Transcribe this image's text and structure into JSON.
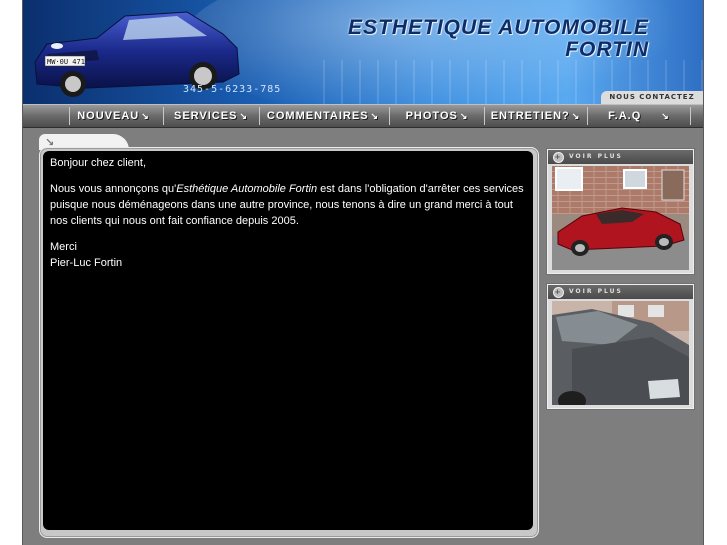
{
  "header": {
    "title_line1": "ESTHETIQUE AUTOMOBILE",
    "title_line2": "FORTIN",
    "phone": "345-5-6233-785",
    "contact_tab": "NOUS CONTACTEZ",
    "plate": "MW·0U 471"
  },
  "nav": {
    "items": [
      {
        "label": "NOUVEAU"
      },
      {
        "label": "SERVICES"
      },
      {
        "label": "COMMENTAIRES"
      },
      {
        "label": "PHOTOS"
      },
      {
        "label": "ENTRETIEN?"
      },
      {
        "label": "F.A.Q"
      }
    ],
    "arrow": "↘"
  },
  "content": {
    "greeting": "Bonjour chez client,",
    "para_before": "Nous vous annonçons qu'",
    "company_name": "Esthétique Automobile Fortin",
    "para_after": " est dans l'obligation d'arrêter ces services puisque nous déménageons dans une autre province, nous tenons à dire un grand merci à tout nos clients qui nous ont fait confiance depuis 2005.",
    "thanks": "Merci",
    "signature": "Pier-Luc Fortin"
  },
  "sidebar": {
    "cards": [
      {
        "heading": "VOIR PLUS",
        "photo": "red-sports-car-photo"
      },
      {
        "heading": "VOIR PLUS",
        "photo": "grey-sedan-photo"
      }
    ]
  },
  "colors": {
    "banner_blue": "#1a5fb4",
    "title_navy": "#0c2d68",
    "frame_grey": "#7e7e7e",
    "content_bg": "#000000"
  }
}
